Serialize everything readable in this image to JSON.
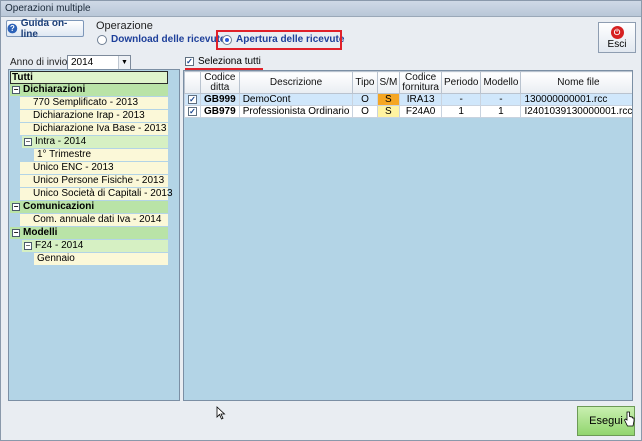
{
  "window": {
    "title": "Operazioni multiple"
  },
  "header": {
    "help_label": "Guida on-line",
    "operation_label": "Operazione",
    "radio_download": "Download delle ricevute",
    "radio_apertura": "Apertura delle ricevute",
    "selected_radio": "Apertura delle ricevute",
    "exit_label": "Esci"
  },
  "filter": {
    "year_label": "Anno di invio",
    "year_value": "2014"
  },
  "tree": {
    "root": "Tutti",
    "items": [
      {
        "label": "Dichiarazioni",
        "type": "cat"
      },
      {
        "label": "770 Semplificato - 2013",
        "type": "leaf2"
      },
      {
        "label": "Dichiarazione Irap - 2013",
        "type": "leaf2"
      },
      {
        "label": "Dichiarazione Iva Base - 2013",
        "type": "leaf2"
      },
      {
        "label": "Intra - 2014",
        "type": "subexp"
      },
      {
        "label": "1° Trimestre",
        "type": "leaf"
      },
      {
        "label": "Unico ENC - 2013",
        "type": "leaf2"
      },
      {
        "label": "Unico Persone Fisiche - 2013",
        "type": "leaf2"
      },
      {
        "label": "Unico Società di Capitali - 2013",
        "type": "leaf2"
      },
      {
        "label": "Comunicazioni",
        "type": "cat"
      },
      {
        "label": "Com. annuale dati Iva - 2014",
        "type": "leaf2"
      },
      {
        "label": "Modelli",
        "type": "cat"
      },
      {
        "label": "F24 - 2014",
        "type": "subexp"
      },
      {
        "label": "Gennaio",
        "type": "leaf"
      }
    ]
  },
  "grid": {
    "select_all_label": "Seleziona tutti",
    "headers": [
      "Codice ditta",
      "Descrizione",
      "Tipo",
      "S/M",
      "Codice fornitura",
      "Periodo",
      "Modello",
      "Nome file"
    ],
    "rows": [
      {
        "checked": true,
        "code": "GB999",
        "description": "DemoCont",
        "tipo": "O",
        "sm": "S",
        "fornitura": "IRA13",
        "periodo": "-",
        "modello": "-",
        "file": "130000000001.rcc"
      },
      {
        "checked": true,
        "code": "GB979",
        "description": "Professionista Ordinario",
        "tipo": "O",
        "sm": "S",
        "fornitura": "F24A0",
        "periodo": "1",
        "modello": "1",
        "file": "I2401039130000001.rcc"
      }
    ]
  },
  "footer": {
    "execute_label": "Esegui"
  }
}
